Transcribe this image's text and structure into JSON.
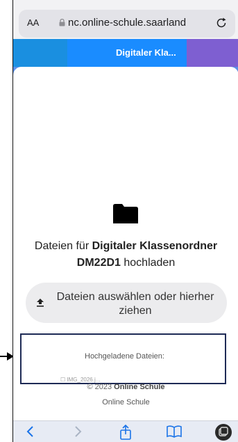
{
  "browser": {
    "aa_label": "AA",
    "url": "nc.online-schule.saarland"
  },
  "header": {
    "title": "Digitaler Kla..."
  },
  "upload": {
    "title_part1": "Dateien für ",
    "title_bold": "Digitaler Klassenordner DM22D1",
    "title_part2": " hochladen",
    "button_label": "Dateien auswählen oder hierher ziehen"
  },
  "uploaded": {
    "title": "Hochgeladene Dateien:",
    "peek": "☐ IMG_2026.j..."
  },
  "footer": {
    "copyright": "© 2023 ",
    "brand": "Online Schule",
    "name": "Online Schule"
  },
  "colors": {
    "band_left": "#1a8fe0",
    "band_mid": "#1a8cff",
    "band_right": "#7e5fd1",
    "toolbar_icons": "#1a73e8"
  }
}
